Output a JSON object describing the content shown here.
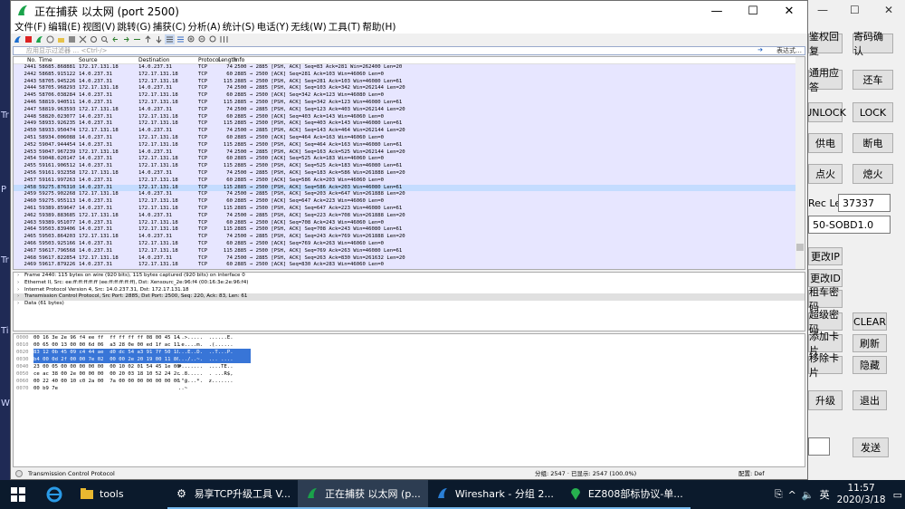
{
  "window": {
    "title": "正在捕获 以太网 (port 2500)",
    "controls": [
      "—",
      "☐",
      "✕"
    ]
  },
  "menu": [
    "文件(F)",
    "编辑(E)",
    "视图(V)",
    "跳转(G)",
    "捕获(C)",
    "分析(A)",
    "统计(S)",
    "电话(Y)",
    "无线(W)",
    "工具(T)",
    "帮助(H)"
  ],
  "filter": {
    "placeholder": "应用显示过滤器 … <Ctrl-/>",
    "expression_label": "表达式…",
    "arrow": "➔"
  },
  "packet_list": {
    "headers": [
      "No.",
      "Time",
      "Source",
      "Destination",
      "Protocol",
      "Length",
      "Info"
    ],
    "rows": [
      [
        "2441",
        "58685.868881",
        "172.17.131.18",
        "14.0.237.31",
        "TCP",
        "74",
        "2500 → 2885 [PSH, ACK] Seq=83 Ack=281 Win=262400 Len=20"
      ],
      [
        "2442",
        "58685.915122",
        "14.0.237.31",
        "172.17.131.18",
        "TCP",
        "60",
        "2885 → 2500 [ACK] Seq=281 Ack=103 Win=46060 Len=0"
      ],
      [
        "2443",
        "58705.945226",
        "14.0.237.31",
        "172.17.131.18",
        "TCP",
        "115",
        "2885 → 2500 [PSH, ACK] Seq=281 Ack=103 Win=46080 Len=61"
      ],
      [
        "2444",
        "58705.968293",
        "172.17.131.18",
        "14.0.237.31",
        "TCP",
        "74",
        "2500 → 2885 [PSH, ACK] Seq=103 Ack=342 Win=262144 Len=20"
      ],
      [
        "2445",
        "58706.038284",
        "14.0.237.31",
        "172.17.131.18",
        "TCP",
        "60",
        "2885 → 2500 [ACK] Seq=342 Ack=123 Win=46080 Len=0"
      ],
      [
        "2446",
        "58819.940511",
        "14.0.237.31",
        "172.17.131.18",
        "TCP",
        "115",
        "2885 → 2500 [PSH, ACK] Seq=342 Ack=123 Win=46080 Len=61"
      ],
      [
        "2447",
        "58819.963593",
        "172.17.131.18",
        "14.0.237.31",
        "TCP",
        "74",
        "2500 → 2885 [PSH, ACK] Seq=123 Ack=403 Win=262144 Len=20"
      ],
      [
        "2448",
        "58820.023077",
        "14.0.237.31",
        "172.17.131.18",
        "TCP",
        "60",
        "2885 → 2500 [ACK] Seq=403 Ack=143 Win=46060 Len=0"
      ],
      [
        "2449",
        "58933.926235",
        "14.0.237.31",
        "172.17.131.18",
        "TCP",
        "115",
        "2885 → 2500 [PSH, ACK] Seq=403 Ack=143 Win=46080 Len=61"
      ],
      [
        "2450",
        "58933.950474",
        "172.17.131.18",
        "14.0.237.31",
        "TCP",
        "74",
        "2500 → 2885 [PSH, ACK] Seq=143 Ack=464 Win=262144 Len=20"
      ],
      [
        "2451",
        "58934.006088",
        "14.0.237.31",
        "172.17.131.18",
        "TCP",
        "60",
        "2885 → 2500 [ACK] Seq=464 Ack=163 Win=46060 Len=0"
      ],
      [
        "2452",
        "59047.944454",
        "14.0.237.31",
        "172.17.131.18",
        "TCP",
        "115",
        "2885 → 2500 [PSH, ACK] Seq=464 Ack=163 Win=46080 Len=61"
      ],
      [
        "2453",
        "59047.967239",
        "172.17.131.18",
        "14.0.237.31",
        "TCP",
        "74",
        "2500 → 2885 [PSH, ACK] Seq=163 Ack=525 Win=262144 Len=20"
      ],
      [
        "2454",
        "59048.020147",
        "14.0.237.31",
        "172.17.131.18",
        "TCP",
        "60",
        "2885 → 2500 [ACK] Seq=525 Ack=183 Win=46060 Len=0"
      ],
      [
        "2455",
        "59161.906512",
        "14.0.237.31",
        "172.17.131.18",
        "TCP",
        "115",
        "2885 → 2500 [PSH, ACK] Seq=525 Ack=183 Win=46080 Len=61"
      ],
      [
        "2456",
        "59161.932358",
        "172.17.131.18",
        "14.0.237.31",
        "TCP",
        "74",
        "2500 → 2885 [PSH, ACK] Seq=183 Ack=586 Win=261888 Len=20"
      ],
      [
        "2457",
        "59161.997263",
        "14.0.237.31",
        "172.17.131.18",
        "TCP",
        "60",
        "2885 → 2500 [ACK] Seq=586 Ack=203 Win=46060 Len=0"
      ],
      [
        "2458",
        "59275.876310",
        "14.0.237.31",
        "172.17.131.18",
        "TCP",
        "115",
        "2885 → 2500 [PSH, ACK] Seq=586 Ack=203 Win=46080 Len=61"
      ],
      [
        "2459",
        "59275.902268",
        "172.17.131.18",
        "14.0.237.31",
        "TCP",
        "74",
        "2500 → 2885 [PSH, ACK] Seq=203 Ack=647 Win=261888 Len=20"
      ],
      [
        "2460",
        "59275.955113",
        "14.0.237.31",
        "172.17.131.18",
        "TCP",
        "60",
        "2885 → 2500 [ACK] Seq=647 Ack=223 Win=46060 Len=0"
      ],
      [
        "2461",
        "59389.859647",
        "14.0.237.31",
        "172.17.131.18",
        "TCP",
        "115",
        "2885 → 2500 [PSH, ACK] Seq=647 Ack=223 Win=46080 Len=61"
      ],
      [
        "2462",
        "59389.883685",
        "172.17.131.18",
        "14.0.237.31",
        "TCP",
        "74",
        "2500 → 2885 [PSH, ACK] Seq=223 Ack=708 Win=261888 Len=20"
      ],
      [
        "2463",
        "59389.951077",
        "14.0.237.31",
        "172.17.131.18",
        "TCP",
        "60",
        "2885 → 2500 [ACK] Seq=708 Ack=243 Win=46060 Len=0"
      ],
      [
        "2464",
        "59503.839406",
        "14.0.237.31",
        "172.17.131.18",
        "TCP",
        "115",
        "2885 → 2500 [PSH, ACK] Seq=708 Ack=243 Win=46080 Len=61"
      ],
      [
        "2465",
        "59503.864203",
        "172.17.131.18",
        "14.0.237.31",
        "TCP",
        "74",
        "2500 → 2885 [PSH, ACK] Seq=243 Ack=769 Win=261888 Len=20"
      ],
      [
        "2466",
        "59503.925166",
        "14.0.237.31",
        "172.17.131.18",
        "TCP",
        "60",
        "2885 → 2500 [ACK] Seq=769 Ack=263 Win=46060 Len=0"
      ],
      [
        "2467",
        "59617.796568",
        "14.0.237.31",
        "172.17.131.18",
        "TCP",
        "115",
        "2885 → 2500 [PSH, ACK] Seq=769 Ack=263 Win=46080 Len=61"
      ],
      [
        "2468",
        "59617.822854",
        "172.17.131.18",
        "14.0.237.31",
        "TCP",
        "74",
        "2500 → 2885 [PSH, ACK] Seq=263 Ack=830 Win=261632 Len=20"
      ],
      [
        "2469",
        "59617.879226",
        "14.0.237.31",
        "172.17.131.18",
        "TCP",
        "60",
        "2885 → 2500 [ACK] Seq=830 Ack=283 Win=46060 Len=0"
      ]
    ]
  },
  "details": [
    {
      "text": "Frame 2440: 115 bytes on wire (920 bits), 115 bytes captured (920 bits) on interface 0",
      "highlight": false
    },
    {
      "text": "Ethernet II, Src: ee:ff:ff:ff:ff:ff (ee:ff:ff:ff:ff:ff), Dst: Xensourc_2e:96:f4 (00:16:3e:2e:96:f4)",
      "highlight": false
    },
    {
      "text": "Internet Protocol Version 4, Src: 14.0.237.31, Dst: 172.17.131.18",
      "highlight": false
    },
    {
      "text": "Transmission Control Protocol, Src Port: 2885, Dst Port: 2500, Seq: 220, Ack: 83, Len: 61",
      "highlight": true
    },
    {
      "text": "Data (61 bytes)",
      "highlight": false
    }
  ],
  "bytes": [
    {
      "off": "0000",
      "hex": "00 16 3e 2e 96 f4 ee ff  ff ff ff ff 08 00 45 14",
      "asc": "..>.....  ......E."
    },
    {
      "off": "0010",
      "hex": "00 65 00 13 00 00 6d 06  a3 28 0e 00 ed 1f ac 11",
      "asc": ".e....m.  .(......"
    },
    {
      "off": "0020",
      "hex": "83 12 0b 45 09 c4 44 ae  d0 dc 54 a3 91 7f 50 18",
      "asc": "...E..D.  ..T...P."
    },
    {
      "off": "0030",
      "hex": "b4 00 0d 2f 00 00 7e 02  00 00 2e 20 19 00 11 86",
      "asc": ".../..~.  ... ...."
    },
    {
      "off": "0040",
      "hex": "23 00 05 00 00 00 00 00  00 10 02 01 54 45 1e 06",
      "asc": "#.......  ....TE.."
    },
    {
      "off": "0050",
      "hex": "ce ac 38 00 2e 00 00 00  00 20 03 18 10 52 24 2c",
      "asc": "..8.....  . ...R$,"
    },
    {
      "off": "0060",
      "hex": "00 22 40 00 10 c0 2a 00  7a 00 00 00 00 00 00 00",
      "asc": ".\"@...*.  z......."
    },
    {
      "off": "0070",
      "hex": "00 b9 7e",
      "asc": "..~"
    }
  ],
  "status": {
    "left": "Transmission Control Protocol",
    "packets": "分组: 2547 · 已显示: 2547 (100.0%)",
    "profile": "配置: Def"
  },
  "bg_app": {
    "left_chars": [
      "Tr",
      "P",
      "Tr",
      "Ti",
      "W"
    ],
    "buttons": [
      {
        "name": "auth-reply-button",
        "label": "鉴权回复"
      },
      {
        "name": "key-confirm-button",
        "label": "寄码确认"
      },
      {
        "name": "general-reply-button",
        "label": "通用应答"
      },
      {
        "name": "return-car-button",
        "label": "还车"
      },
      {
        "name": "unlock-button",
        "label": "UNLOCK"
      },
      {
        "name": "lock-button",
        "label": "LOCK"
      },
      {
        "name": "power-supply-button",
        "label": "供电"
      },
      {
        "name": "power-off-button",
        "label": "断电"
      },
      {
        "name": "ignite-button",
        "label": "点火"
      },
      {
        "name": "flameout-button",
        "label": "熄火"
      },
      {
        "name": "change-ip-button",
        "label": "更改IP"
      },
      {
        "name": "change-id-button",
        "label": "更改ID"
      },
      {
        "name": "rent-password-button",
        "label": "租车密码"
      },
      {
        "name": "super-password-button",
        "label": "超级密码"
      },
      {
        "name": "clear-button",
        "label": "CLEAR"
      },
      {
        "name": "add-card-button",
        "label": "添加卡片"
      },
      {
        "name": "refresh-button",
        "label": "刷新"
      },
      {
        "name": "remove-card-button",
        "label": "移除卡片"
      },
      {
        "name": "hide-button",
        "label": "隐藏"
      },
      {
        "name": "upgrade-button",
        "label": "升级"
      },
      {
        "name": "exit-button",
        "label": "退出"
      },
      {
        "name": "send-button",
        "label": "发送"
      }
    ],
    "rec_len_label": "Rec Len",
    "rec_len_value": "37337",
    "model_value": "50-SOBD1.0",
    "window_controls": [
      "—",
      "☐",
      "✕"
    ]
  },
  "taskbar": {
    "items": [
      {
        "name": "taskbar-tools",
        "label": "tools",
        "state": "normal"
      },
      {
        "name": "taskbar-tcp-upgrade",
        "label": "易享TCP升级工具 V...",
        "state": "open"
      },
      {
        "name": "taskbar-capturing",
        "label": "正在捕获 以太网 (p...",
        "state": "active"
      },
      {
        "name": "taskbar-wireshark-group",
        "label": "Wireshark - 分组 2...",
        "state": "open"
      },
      {
        "name": "taskbar-ez808",
        "label": "EZ808部标协议-单...",
        "state": "open"
      }
    ],
    "ime": "英",
    "time": "11:57",
    "date": "2020/3/18"
  }
}
